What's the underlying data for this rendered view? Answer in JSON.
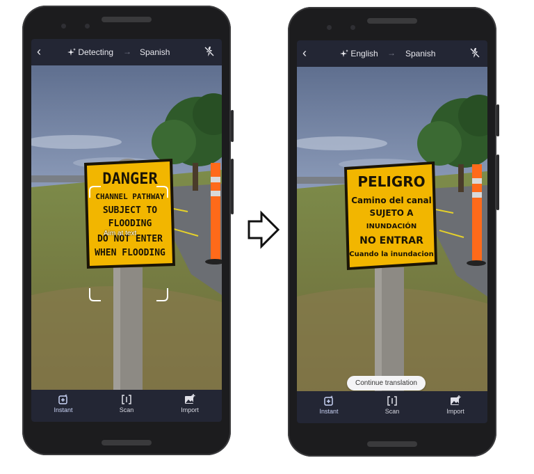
{
  "left_phone": {
    "source_lang": "Detecting",
    "target_lang": "Spanish",
    "aim_text": "Aim at text",
    "sign": {
      "line1": "DANGER",
      "line2": "CHANNEL PATHWAY",
      "line3": "SUBJECT TO",
      "line4": "FLOODING",
      "line5": "DO NOT ENTER",
      "line6": "WHEN FLOODING"
    }
  },
  "right_phone": {
    "source_lang": "English",
    "target_lang": "Spanish",
    "continue_label": "Continue translation",
    "sign": {
      "line1": "PELIGRO",
      "line2": "Camino del canal",
      "line3": "SUJETO A",
      "line4": "INUNDACIÓN",
      "line5": "NO ENTRAR",
      "line6": "Cuando la inundacion"
    }
  },
  "toolbar": {
    "instant_label": "Instant",
    "scan_label": "Scan",
    "import_label": "Import"
  },
  "icons": {
    "back": "back-arrow-icon",
    "sparkle": "sparkle-icon",
    "swap": "arrow-right-icon",
    "flash": "flash-off-icon",
    "instant": "instant-icon",
    "scan": "scan-icon",
    "import": "import-icon",
    "transition": "right-arrow-icon"
  },
  "colors": {
    "sign_yellow": "#f2b600",
    "bar_bg": "#232634",
    "sky": "#8ea1c2"
  }
}
